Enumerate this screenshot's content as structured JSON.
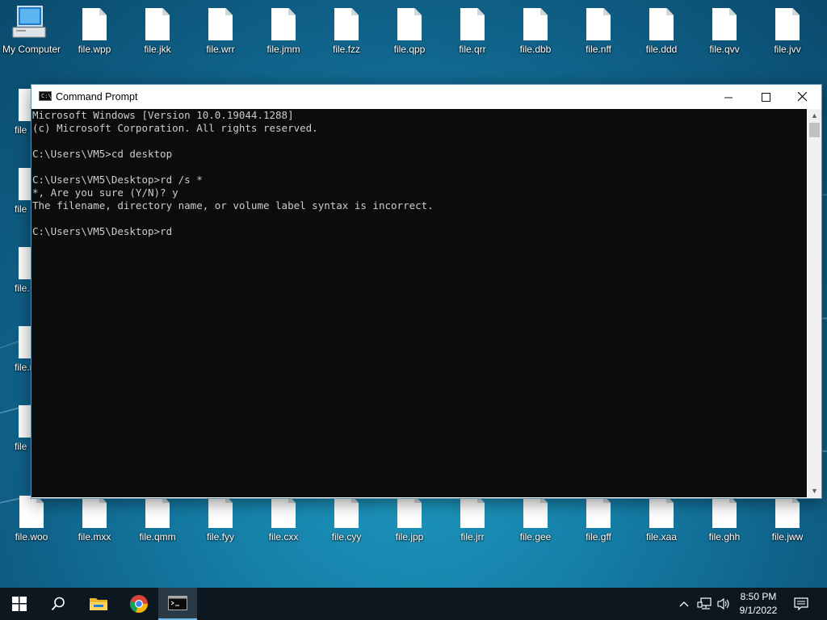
{
  "desktop": {
    "top_row": [
      {
        "label": "My Computer",
        "type": "computer"
      },
      {
        "label": "file.wpp"
      },
      {
        "label": "file.jkk"
      },
      {
        "label": "file.wrr"
      },
      {
        "label": "file.jmm"
      },
      {
        "label": "file.fzz"
      },
      {
        "label": "file.qpp"
      },
      {
        "label": "file.qrr"
      },
      {
        "label": "file.dbb"
      },
      {
        "label": "file.nff"
      },
      {
        "label": "file.ddd"
      },
      {
        "label": "file.qvv"
      },
      {
        "label": "file.jvv"
      }
    ],
    "left_column": [
      {
        "label": "file.",
        "visible_label": "file"
      },
      {
        "label": "file",
        "visible_label": "file"
      },
      {
        "label": "file.",
        "visible_label": "file."
      },
      {
        "label": "file.r",
        "visible_label": "file.r"
      },
      {
        "label": "file",
        "visible_label": "file"
      }
    ],
    "bottom_row": [
      {
        "label": "file.woo"
      },
      {
        "label": "file.mxx"
      },
      {
        "label": "file.qmm"
      },
      {
        "label": "file.fyy"
      },
      {
        "label": "file.cxx"
      },
      {
        "label": "file.cyy"
      },
      {
        "label": "file.jpp"
      },
      {
        "label": "file.jrr"
      },
      {
        "label": "file.gee"
      },
      {
        "label": "file.gff"
      },
      {
        "label": "file.xaa"
      },
      {
        "label": "file.ghh"
      },
      {
        "label": "file.jww"
      }
    ]
  },
  "window": {
    "title": "Command Prompt",
    "icon": "cmd-icon",
    "controls": {
      "minimize": "—",
      "maximize": "☐",
      "close": "✕"
    },
    "console_lines": [
      "Microsoft Windows [Version 10.0.19044.1288]",
      "(c) Microsoft Corporation. All rights reserved.",
      "",
      "C:\\Users\\VM5>cd desktop",
      "",
      "C:\\Users\\VM5\\Desktop>rd /s *",
      "*, Are you sure (Y/N)? y",
      "The filename, directory name, or volume label syntax is incorrect.",
      "",
      "C:\\Users\\VM5\\Desktop>rd"
    ],
    "colors": {
      "console_bg": "#0c0c0c",
      "console_fg": "#cccccc"
    }
  },
  "taskbar": {
    "buttons": [
      {
        "name": "start-button",
        "icon": "windows-logo-icon"
      },
      {
        "name": "search-button",
        "icon": "search-icon"
      },
      {
        "name": "file-explorer-button",
        "icon": "folder-icon"
      },
      {
        "name": "chrome-button",
        "icon": "chrome-icon"
      },
      {
        "name": "cmd-taskbar-button",
        "icon": "cmd-icon",
        "active": true
      }
    ],
    "tray": {
      "chevron": "^",
      "network": "network-icon",
      "volume": "volume-icon"
    },
    "clock": {
      "time": "8:50 PM",
      "date": "9/1/2022"
    },
    "notification": "notification-icon"
  }
}
